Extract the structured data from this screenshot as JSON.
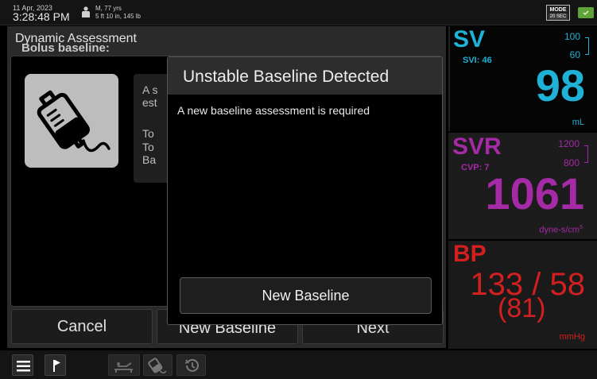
{
  "status_bar": {
    "date": "11 Apr, 2023",
    "time": "3:28:48 PM",
    "patient_line1": "M, 77 yrs",
    "patient_line2": "5 ft 10 in, 145 lb",
    "mode_label": "MODE",
    "mode_value": "20 SEC"
  },
  "main": {
    "title": "Dynamic Assessment",
    "bolus_label": "Bolus baseline:",
    "partial_text": [
      "A s",
      "est",
      "",
      "To",
      "To",
      "Ba"
    ],
    "cancel_label": "Cancel",
    "new_baseline_label": "New Baseline",
    "next_label": "Next"
  },
  "modal": {
    "title": "Unstable Baseline Detected",
    "message": "A new baseline assessment is required",
    "button_label": "New Baseline"
  },
  "tiles": {
    "sv": {
      "name": "SV",
      "sub": "SVI: 46",
      "range_high": "100",
      "range_low": "60",
      "value": "98",
      "unit": "mL",
      "color": "#1fb1d6"
    },
    "svr": {
      "name": "SVR",
      "sub": "CVP: 7",
      "range_high": "1200",
      "range_low": "800",
      "value": "1061",
      "unit": "dyne-s/cm",
      "unit_sup": "5",
      "color": "#a52aa5"
    },
    "bp": {
      "name": "BP",
      "value": "133 / 58",
      "map": "(81)",
      "unit": "mmHg",
      "color": "#d21f1f"
    }
  },
  "toolbar": {
    "icons": [
      "menu-icon",
      "flag-icon",
      "patient-bed-icon",
      "iv-bag-icon",
      "history-icon"
    ]
  },
  "colors": {
    "battery": "#5fa33a"
  }
}
